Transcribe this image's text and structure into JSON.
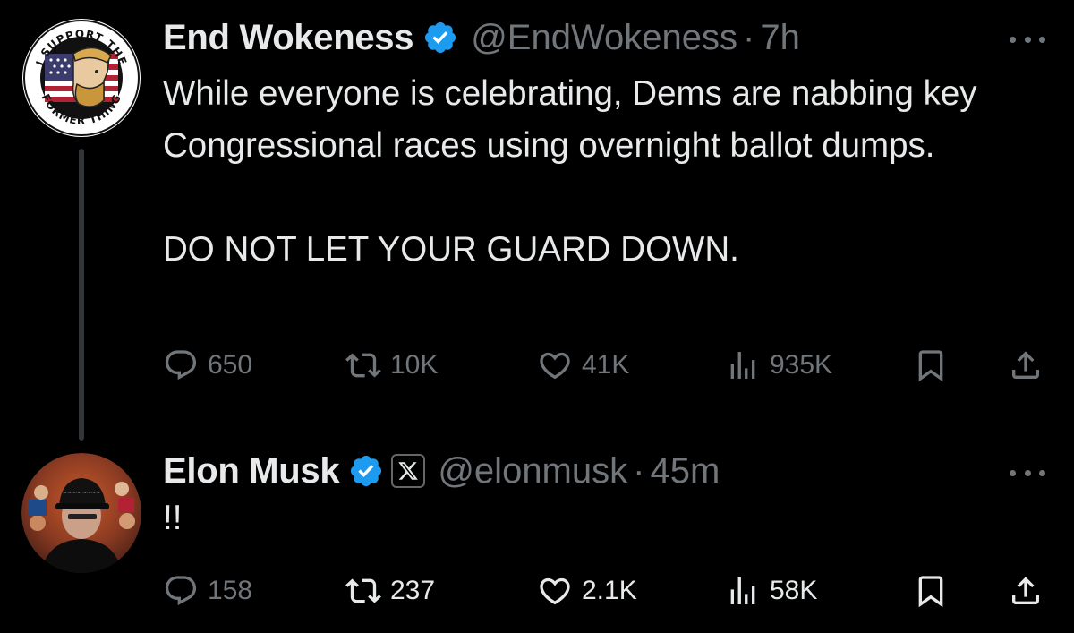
{
  "tweets": [
    {
      "display_name": "End Wokeness",
      "handle": "@EndWokeness",
      "separator": "·",
      "time": "7h",
      "text": "While everyone is celebrating, Dems are nabbing key Congressional races using overnight ballot dumps.\n\nDO NOT LET YOUR GUARD DOWN.",
      "avatar_text_top": "I SUPPORT THE",
      "avatar_text_bottom": "FORMER THING",
      "counts": {
        "replies": "650",
        "retweets": "10K",
        "likes": "41K",
        "views": "935K"
      }
    },
    {
      "display_name": "Elon Musk",
      "handle": "@elonmusk",
      "separator": "·",
      "time": "45m",
      "text": "!!",
      "counts": {
        "replies": "158",
        "retweets": "237",
        "likes": "2.1K",
        "views": "58K"
      }
    }
  ],
  "icons": {
    "reply": "reply-icon",
    "retweet": "retweet-icon",
    "like": "heart-icon",
    "views": "views-icon",
    "bookmark": "bookmark-icon",
    "share": "share-icon",
    "verified": "verified-badge-icon",
    "affiliate": "x-logo-icon",
    "more": "more-options-icon"
  },
  "colors": {
    "background": "#000000",
    "text": "#e7e9ea",
    "muted": "#71767b",
    "verified": "#1d9bf0",
    "thread_line": "#333639"
  }
}
